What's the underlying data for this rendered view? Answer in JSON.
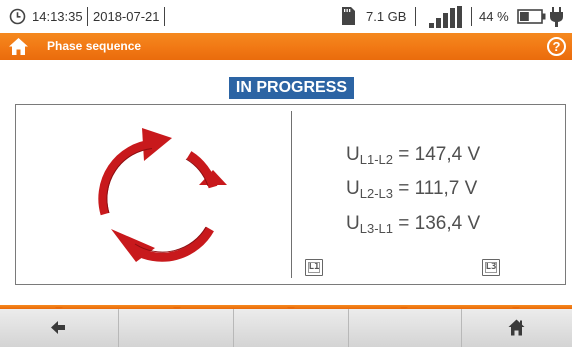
{
  "status_bar": {
    "time": "14:13:35",
    "date": "2018-07-21",
    "storage": "7.1 GB",
    "battery_percent": "44 %",
    "battery_level": 0.44,
    "signal_bars": 4,
    "icons": [
      "clock-icon",
      "sd-card-icon",
      "signal-icon",
      "battery-icon",
      "plug-icon"
    ]
  },
  "header": {
    "title": "Phase sequence",
    "help_symbol": "?",
    "icons": [
      "home-icon",
      "help-icon"
    ]
  },
  "status_label": "IN PROGRESS",
  "measurement": {
    "rotation_indicator": "circular-arrows-clockwise",
    "readings": [
      {
        "symbol": "U",
        "sub": "L1-L2",
        "eq": " = 147,4 V"
      },
      {
        "symbol": "U",
        "sub": "L2-L3",
        "eq": " = 111,7 V"
      },
      {
        "symbol": "U",
        "sub": "L3-L1",
        "eq": " = 136,4 V"
      }
    ],
    "phase_tags": [
      "L1",
      "L3"
    ]
  },
  "toolbar": {
    "buttons": [
      "back-icon",
      "",
      "",
      "",
      "home-icon"
    ]
  },
  "colors": {
    "accent_orange": "#f17814",
    "status_blue": "#2c64a4",
    "arrow_red": "#c8191c",
    "toolbar_gray": "#d4d4d4"
  }
}
